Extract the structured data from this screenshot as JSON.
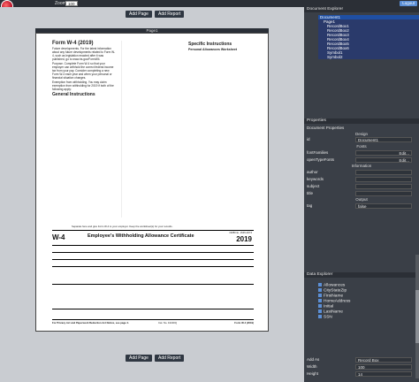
{
  "toolbar": {
    "title": "Zoom",
    "zoom": "100",
    "logout": "Logout"
  },
  "canvas": {
    "add_page": "Add Page",
    "add_report": "Add Report",
    "page_tab": "Page1",
    "form": {
      "title_line": "Form W-4 (2019)",
      "future_dev": "Future developments. For the latest information about any future developments related to Form W-4, such as legislation enacted after it was published, go to www.irs.gov/FormW4.",
      "purpose": "Purpose. Complete Form W-4 so that your employer can withhold the correct federal income tax from your pay. Consider completing a new Form W-4 each year and when your personal or financial situation changes.",
      "exemption": "Exemption from withholding. You may claim exemption from withholding for 2019 if both of the following apply:",
      "gen_instr": "General Instructions",
      "specific_instr": "Specific Instructions",
      "personal_ws": "Personal Allowances Worksheet",
      "w4_big": "W-4",
      "w4_title": "Employee's Withholding Allowance Certificate",
      "year": "2019",
      "omb": "OMB No. 1545-0074",
      "separate": "Separate here and give Form W-4 to your employer. Keep the worksheet(s) for your records.",
      "footer_left": "For Privacy Act and Paperwork Reduction Act Notice, see page 4.",
      "footer_cat": "Cat. No. 10220Q",
      "footer_right": "Form W-4 (2019)"
    }
  },
  "panel": {
    "doc_explorer": "Document Explorer",
    "tree": [
      "Document1",
      "Page1",
      "RecordBox1",
      "RecordBox2",
      "RecordBox3",
      "RecordBox4",
      "RecordBox5",
      "RecordBox6",
      "Symbol1",
      "Symbol2"
    ],
    "properties": "Properties",
    "doc_properties": "Document Properties",
    "design": "Design",
    "id_label": "id",
    "id_value": "Document1",
    "fonts": "Fonts",
    "font_families": "fontFamilies",
    "open_type": "openTypeFonts",
    "edit": "Edit...",
    "information": "Information",
    "author": "author",
    "keywords": "keywords",
    "subject": "subject",
    "title": "title",
    "output": "Output",
    "tag": "tag",
    "tag_value": "false",
    "data_explorer": "Data Explorer",
    "data_nodes": [
      "Allowances",
      "CityStateZip",
      "FirstName",
      "HomeAddress",
      "Initial",
      "LastName",
      "SSN"
    ],
    "add_as": "Add As",
    "add_as_value": "Record Box",
    "width_label": "Width",
    "width_value": "100",
    "height_label": "Height",
    "height_value": "14"
  }
}
